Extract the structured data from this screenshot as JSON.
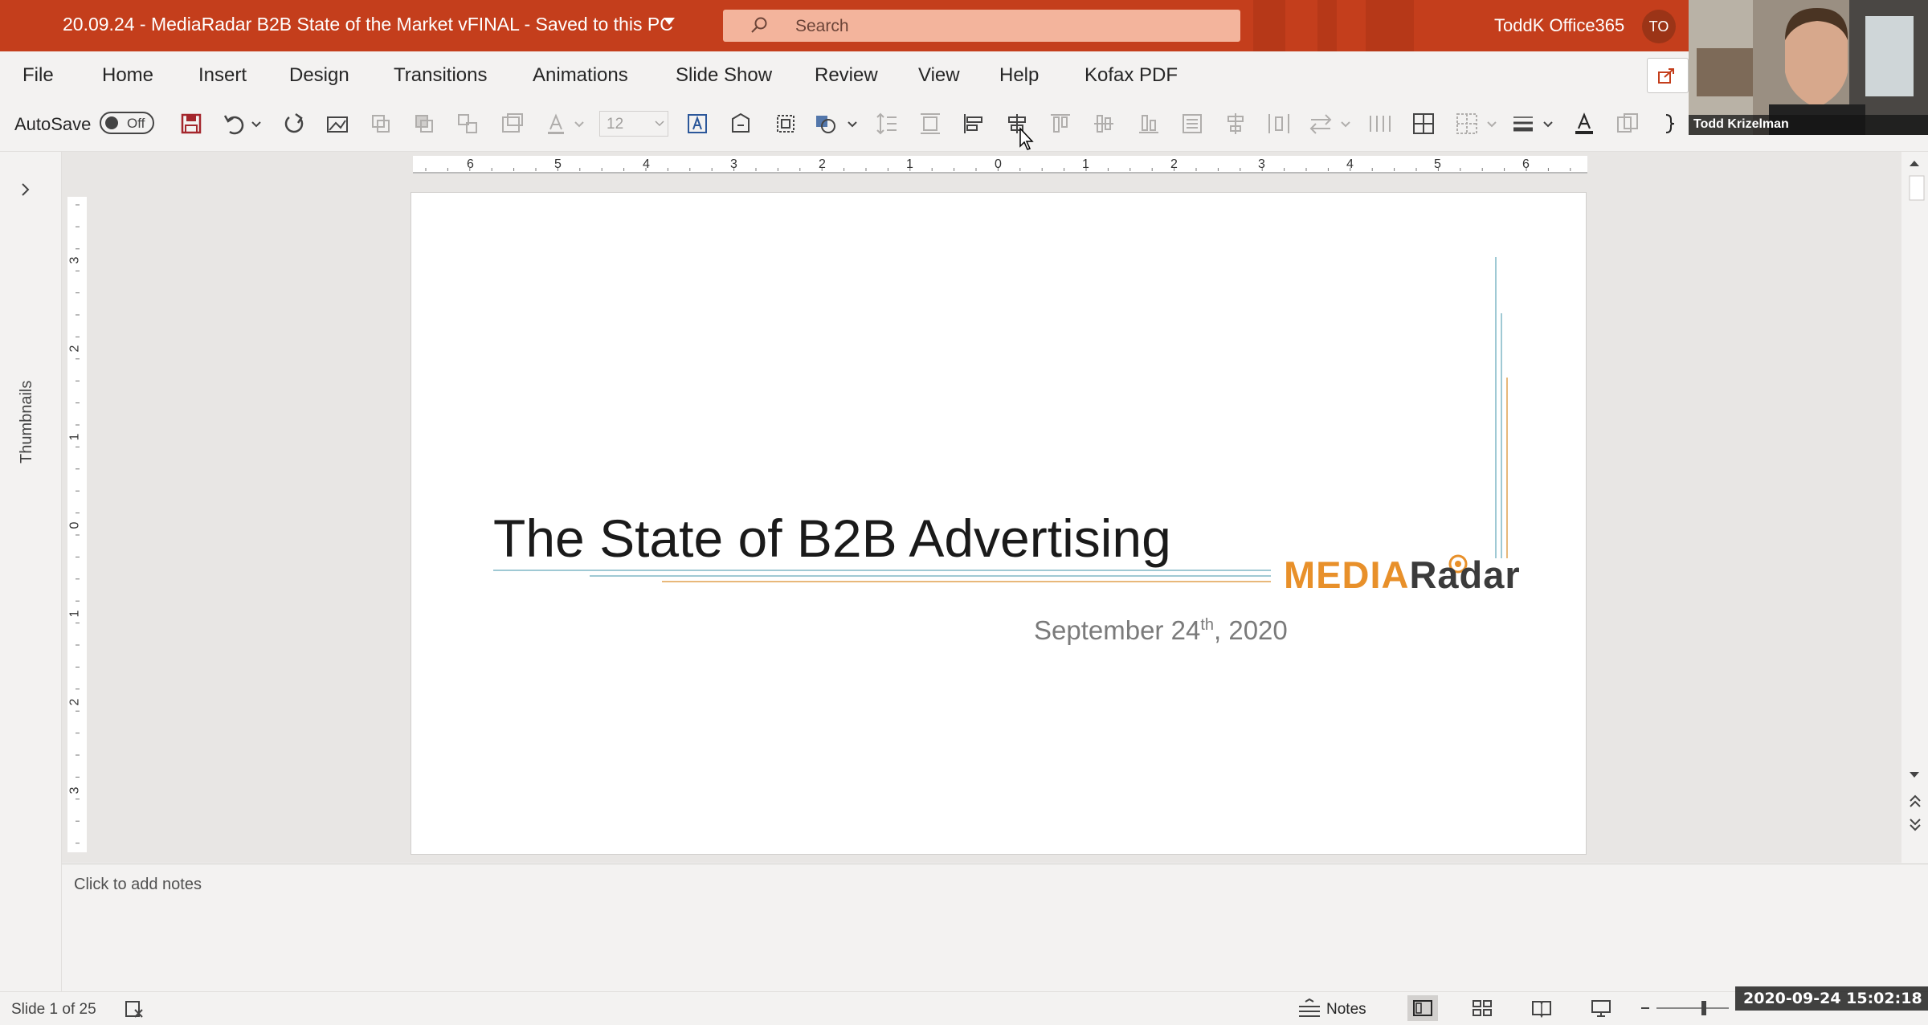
{
  "window": {
    "title": "20.09.24 - MediaRadar B2B State of the Market vFINAL  -  Saved to this PC",
    "search_placeholder": "Search",
    "account_name": "ToddK Office365",
    "account_initials": "TO"
  },
  "menu": {
    "items": [
      "File",
      "Home",
      "Insert",
      "Design",
      "Transitions",
      "Animations",
      "Slide Show",
      "Review",
      "View",
      "Help",
      "Kofax PDF"
    ]
  },
  "toolbar": {
    "autosave_label": "AutoSave",
    "autosave_state": "Off",
    "font_size": "12"
  },
  "webcam": {
    "participant_name": "Todd Krizelman"
  },
  "thumbnails": {
    "label": "Thumbnails"
  },
  "rulers": {
    "horizontal": [
      "6",
      "5",
      "4",
      "3",
      "2",
      "1",
      "0",
      "1",
      "2",
      "3",
      "4",
      "5",
      "6"
    ],
    "vertical": [
      "3",
      "2",
      "1",
      "0",
      "1",
      "2",
      "3"
    ]
  },
  "slide": {
    "title": "The State of B2B Advertising",
    "date_prefix": "September 24",
    "date_sup": "th",
    "date_suffix": ", 2020",
    "logo_part1": "MEDIA",
    "logo_part2": "Radar"
  },
  "notes": {
    "placeholder": "Click to add notes"
  },
  "status": {
    "slide_counter": "Slide 1 of 25",
    "notes_label": "Notes"
  },
  "overlay": {
    "timestamp": "2020-09-24  15:02:18"
  },
  "colors": {
    "titlebar": "#c43e1c",
    "logo_orange": "#e8902a",
    "logo_dark": "#3b3b3b"
  }
}
